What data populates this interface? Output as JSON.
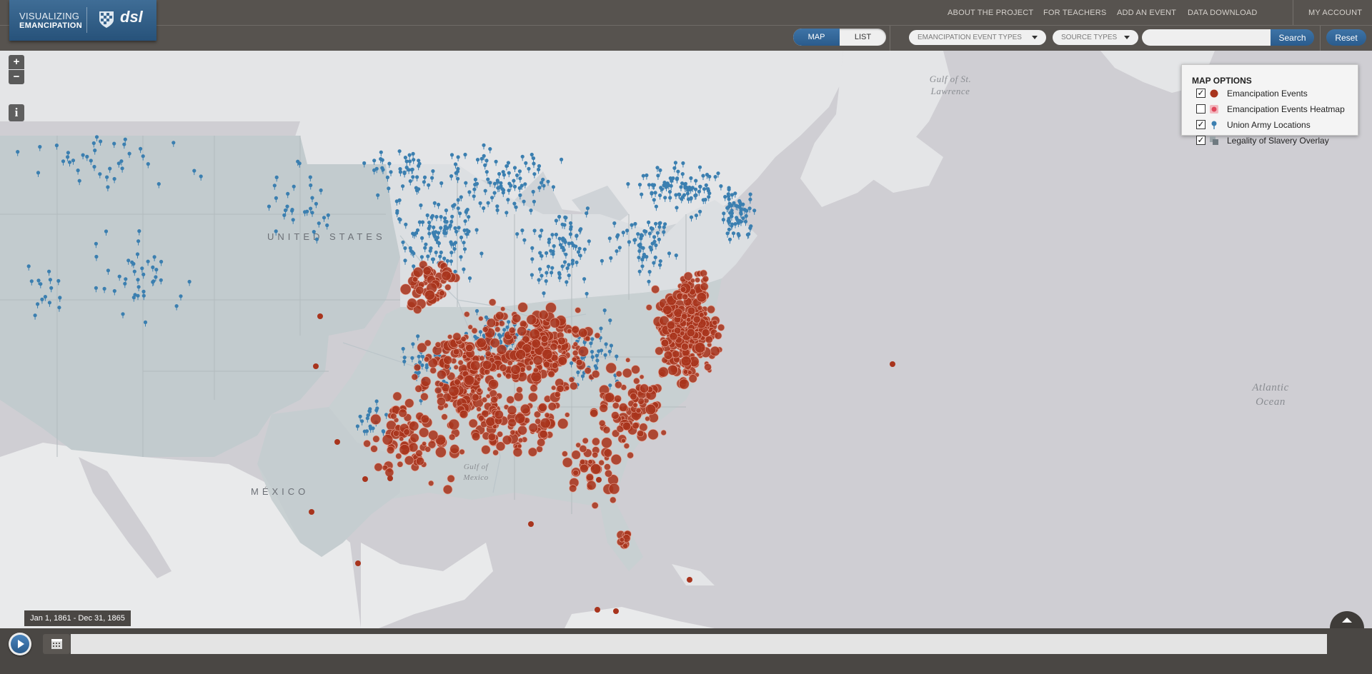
{
  "logo": {
    "line1": "VISUALIZING",
    "line2": "EMANCIPATION",
    "brand": "dsl"
  },
  "nav": {
    "about": "ABOUT THE PROJECT",
    "teachers": "FOR TEACHERS",
    "add_event": "ADD AN EVENT",
    "data_download": "DATA DOWNLOAD",
    "account": "MY ACCOUNT"
  },
  "view_toggle": {
    "map": "MAP",
    "list": "LIST",
    "active": "MAP"
  },
  "filters": {
    "event_types": "EMANCIPATION EVENT TYPES",
    "source_types": "SOURCE TYPES"
  },
  "search": {
    "placeholder": "",
    "button": "Search"
  },
  "reset_label": "Reset",
  "map_controls": {
    "zoom_in": "+",
    "zoom_out": "−",
    "info": "i"
  },
  "map_options": {
    "title": "MAP OPTIONS",
    "items": [
      {
        "label": "Emancipation Events",
        "checked": true,
        "icon": "red-circle-icon"
      },
      {
        "label": "Emancipation Events Heatmap",
        "checked": false,
        "icon": "heatmap-icon"
      },
      {
        "label": "Union Army Locations",
        "checked": true,
        "icon": "blue-pin-icon"
      },
      {
        "label": "Legality of Slavery Overlay",
        "checked": true,
        "icon": "overlay-squares-icon"
      }
    ]
  },
  "map_labels": {
    "united_states": "UNITED STATES",
    "mexico": "MÉXICO",
    "gulf_st_lawrence": [
      "Gulf of St.",
      "Lawrence"
    ],
    "atlantic": [
      "Atlantic",
      "Ocean"
    ],
    "gulf_mexico": [
      "Gulf of",
      "Mexico"
    ]
  },
  "timeline": {
    "date_range": "Jan 1, 1861 - Dec 31, 1865"
  },
  "colors": {
    "event": "#a8341d",
    "union": "#3b7fb0",
    "accent": "#2e6496",
    "bar": "#57534f"
  }
}
